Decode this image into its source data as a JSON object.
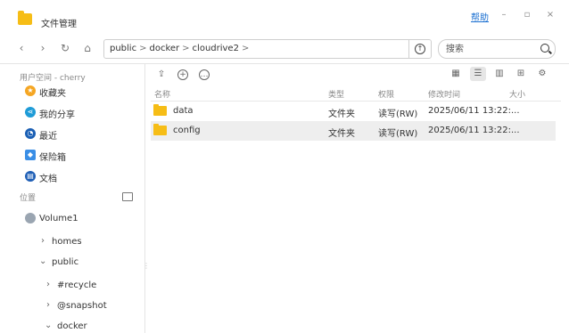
{
  "window": {
    "title": "文件管理",
    "help_label": "帮助",
    "controls": {
      "minimize": "–",
      "maximize": "▫",
      "close": "×"
    }
  },
  "toolbar": {
    "back": "‹",
    "forward": "›",
    "refresh": "↻",
    "home": "⌂",
    "breadcrumbs": [
      "public",
      "docker",
      "cloudrive2"
    ],
    "crumb_separator": ">",
    "go_up": "↑",
    "search_placeholder": "搜索"
  },
  "sidebar": {
    "user_space_label": "用户空间 - cherry",
    "items": [
      {
        "label": "收藏夹",
        "icon": "star-icon",
        "color": "#f5a623"
      },
      {
        "label": "我的分享",
        "icon": "share-icon",
        "color": "#1e9bd7"
      },
      {
        "label": "最近",
        "icon": "clock-icon",
        "color": "#1a5fb4"
      },
      {
        "label": "保险箱",
        "icon": "box-icon",
        "color": "#3a8ee6"
      },
      {
        "label": "文档",
        "icon": "document-icon",
        "color": "#1f5fb6"
      }
    ],
    "location_label": "位置",
    "volume": "Volume1",
    "tree": [
      {
        "label": "homes",
        "expanded": false
      },
      {
        "label": "public",
        "expanded": true
      },
      {
        "label": "#recycle",
        "expanded": false
      },
      {
        "label": "@snapshot",
        "expanded": false
      },
      {
        "label": "docker",
        "expanded": true
      }
    ]
  },
  "main": {
    "actions": {
      "upload": "⇪",
      "new": "+",
      "more": "…"
    },
    "columns": {
      "name": "名称",
      "type": "类型",
      "permission": "权限",
      "modified": "修改时间",
      "size": "大小"
    },
    "files": [
      {
        "name": "data",
        "type": "文件夹",
        "permission": "读写(RW)",
        "modified": "2025/06/11 13:22:...",
        "size": ""
      },
      {
        "name": "config",
        "type": "文件夹",
        "permission": "读写(RW)",
        "modified": "2025/06/11 13:22:...",
        "size": ""
      }
    ],
    "selected_row": 1,
    "view_modes": [
      "grid",
      "list",
      "columns",
      "add",
      "settings"
    ],
    "active_view": "list"
  },
  "colors": {
    "accent": "#1a6fd1",
    "folder": "#f6bd16",
    "selected_row": "#eeeeee"
  }
}
